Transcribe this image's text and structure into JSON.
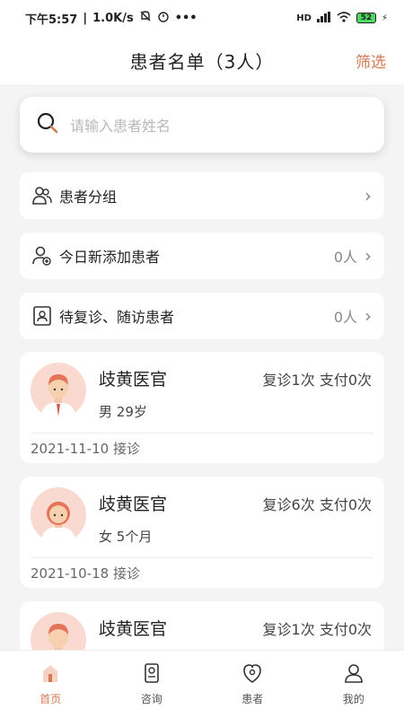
{
  "status_bar": {
    "time": "下午5:57",
    "speed": "1.0K/s",
    "network": "HD",
    "battery": "52"
  },
  "nav": {
    "title": "患者名单（3人）",
    "filter": "筛选"
  },
  "search": {
    "placeholder": "请输入患者姓名"
  },
  "menu": {
    "groups": {
      "label": "患者分组"
    },
    "new_today": {
      "label": "今日新添加患者",
      "count": "0人"
    },
    "followup": {
      "label": "待复诊、随访患者",
      "count": "0人"
    }
  },
  "patients": [
    {
      "name": "歧黄医官",
      "gender": "男",
      "age": "29岁",
      "stats": "复诊1次 支付0次",
      "date": "2021-11-10",
      "status": "接诊"
    },
    {
      "name": "歧黄医官",
      "gender": "女",
      "age": "5个月",
      "stats": "复诊6次 支付0次",
      "date": "2021-10-18",
      "status": "接诊"
    },
    {
      "name": "歧黄医官",
      "stats": "复诊1次 支付0次"
    }
  ],
  "tabs": [
    {
      "label": "首页",
      "icon": "home-icon"
    },
    {
      "label": "咨询",
      "icon": "consult-icon"
    },
    {
      "label": "患者",
      "icon": "patient-icon"
    },
    {
      "label": "我的",
      "icon": "profile-icon"
    }
  ],
  "colors": {
    "accent": "#d27a54",
    "avatar_bg": "#f9d9d0"
  }
}
